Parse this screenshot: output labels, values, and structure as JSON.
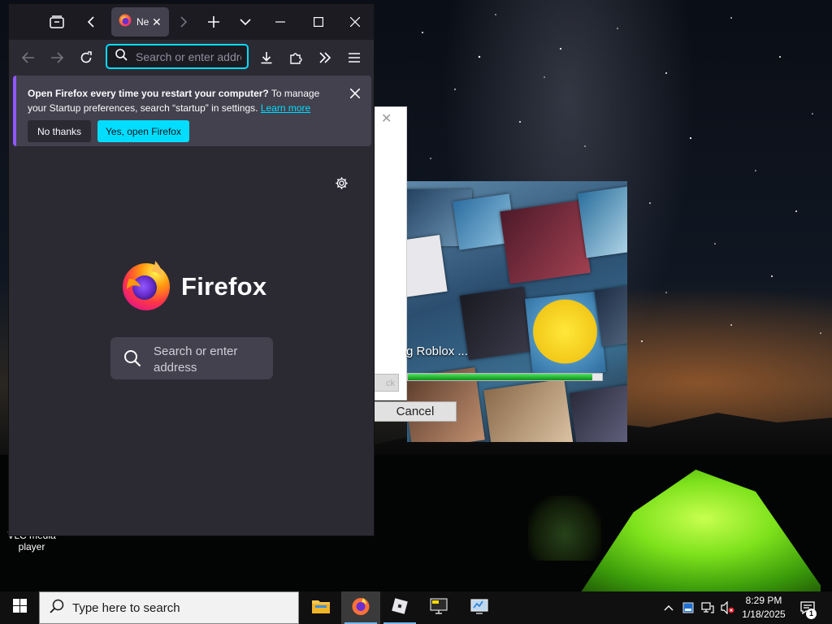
{
  "desktop": {
    "icons": [
      {
        "label": "VLC media player"
      }
    ]
  },
  "roblox_installer": {
    "status_text": "g Roblox ...",
    "progress_fraction": 0.95,
    "back_label": "ck",
    "cancel_label": "Cancel"
  },
  "firefox": {
    "tab": {
      "title": "Ne"
    },
    "urlbar": {
      "placeholder": "Search or enter address"
    },
    "notification": {
      "bold_text": "Open Firefox every time you restart your computer?",
      "text_part1": " To manage your Startup preferences, search “startup” in settings. ",
      "link_text": "Learn more",
      "no_label": "No thanks",
      "yes_label": "Yes, open Firefox"
    },
    "home": {
      "wordmark": "Firefox",
      "search_label": "Search or enter address"
    }
  },
  "taskbar": {
    "search_placeholder": "Type here to search",
    "time": "8:29 PM",
    "date": "1/18/2025",
    "notification_count": "1"
  },
  "colors": {
    "firefox_accent": "#00ddff",
    "firefox_bg": "#2b2a33",
    "taskbar_bg": "#101010",
    "progress_green": "#21b02e"
  }
}
